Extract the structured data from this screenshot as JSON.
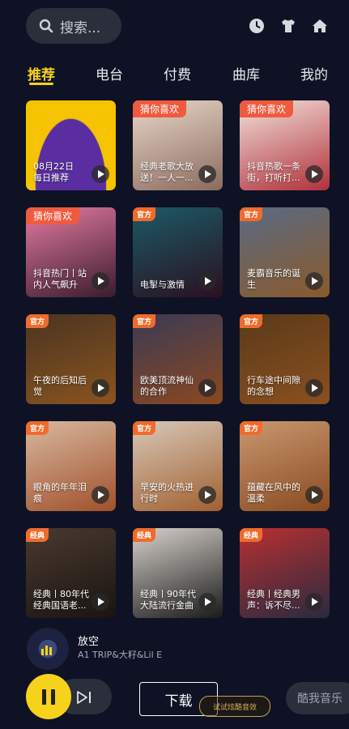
{
  "search": {
    "placeholder": "搜索..."
  },
  "top_icons": [
    "history-clock-icon",
    "tshirt-skin-icon",
    "home-icon"
  ],
  "tabs": [
    {
      "label": "推荐",
      "active": true
    },
    {
      "label": "电台",
      "active": false
    },
    {
      "label": "付费",
      "active": false
    },
    {
      "label": "曲库",
      "active": false
    },
    {
      "label": "我的",
      "active": false
    }
  ],
  "cards": [
    {
      "badge": "",
      "title": "08月22日\n每日推荐",
      "colors": [
        "#f5c300",
        "#7c3ab0"
      ]
    },
    {
      "badge": "猜你喜欢",
      "title": "经典老歌大放送！一人一...",
      "colors": [
        "#e8d7c9",
        "#8a6b5e"
      ]
    },
    {
      "badge": "猜你喜欢",
      "title": "抖音热歌一条街，打听打...",
      "colors": [
        "#f3e2dc",
        "#b0303a"
      ]
    },
    {
      "badge": "猜你喜欢",
      "title": "抖音热门丨站内人气飙升1...",
      "colors": [
        "#e57ba2",
        "#3a1b2e"
      ]
    },
    {
      "badge": "官方",
      "title": "电掣与激情",
      "colors": [
        "#1c5a66",
        "#2a1020"
      ]
    },
    {
      "badge": "官方",
      "title": "麦霸音乐的诞生",
      "colors": [
        "#5a6a85",
        "#8a5a2a"
      ]
    },
    {
      "badge": "官方",
      "title": "午夜的后知后觉",
      "colors": [
        "#4a3420",
        "#8a5420"
      ]
    },
    {
      "badge": "官方",
      "title": "欧美顶流神仙的合作",
      "colors": [
        "#3a3a55",
        "#8a4820"
      ]
    },
    {
      "badge": "官方",
      "title": "行车途中间隙的念想",
      "colors": [
        "#5a3a18",
        "#8a5020"
      ]
    },
    {
      "badge": "官方",
      "title": "眼角的年年泪痕",
      "colors": [
        "#d8b8a0",
        "#a0502a"
      ]
    },
    {
      "badge": "官方",
      "title": "早安的火热进行时",
      "colors": [
        "#d8c8b8",
        "#a06030"
      ]
    },
    {
      "badge": "官方",
      "title": "蕴藏在风中的温柔",
      "colors": [
        "#c89870",
        "#8a4a20"
      ]
    },
    {
      "badge": "经典",
      "title": "经典丨80年代经典国语老...",
      "colors": [
        "#4a3a30",
        "#1a1410"
      ]
    },
    {
      "badge": "经典",
      "title": "经典丨90年代大陆流行金曲",
      "colors": [
        "#d8d2cc",
        "#1a1a1a"
      ]
    },
    {
      "badge": "经典",
      "title": "经典丨经典男声：诉不尽...",
      "colors": [
        "#b83030",
        "#2a2a40"
      ]
    }
  ],
  "player": {
    "song_title": "放空",
    "artist": "A1 TRIP&大籽&Lil E",
    "download_label": "下载",
    "sound_effect_label": "试试炫酷音效",
    "kuwo_label": "酷我音乐"
  },
  "colors": {
    "accent": "#f7d21a",
    "background": "#0e1224",
    "badge": "#f05a3e"
  }
}
